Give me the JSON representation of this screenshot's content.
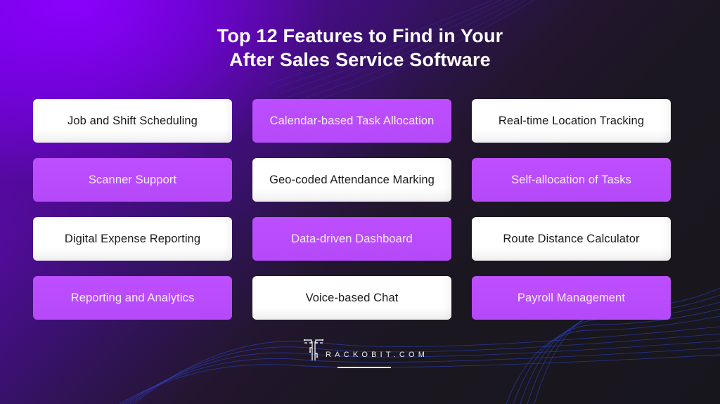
{
  "title": {
    "line1": "Top 12 Features to Find in Your",
    "line2": "After Sales Service Software"
  },
  "features": [
    {
      "label": "Job and Shift Scheduling",
      "style": "white"
    },
    {
      "label": "Calendar-based Task Allocation",
      "style": "purple"
    },
    {
      "label": "Real-time Location Tracking",
      "style": "white"
    },
    {
      "label": "Scanner Support",
      "style": "purple"
    },
    {
      "label": "Geo-coded Attendance Marking",
      "style": "white"
    },
    {
      "label": "Self-allocation of Tasks",
      "style": "purple"
    },
    {
      "label": "Digital Expense Reporting",
      "style": "white"
    },
    {
      "label": "Data-driven Dashboard",
      "style": "purple"
    },
    {
      "label": "Route Distance Calculator",
      "style": "white"
    },
    {
      "label": "Reporting and Analytics",
      "style": "purple"
    },
    {
      "label": "Voice-based Chat",
      "style": "white"
    },
    {
      "label": "Payroll Management",
      "style": "purple"
    }
  ],
  "branding": {
    "logo_icon": "trackobit-t-circuit-icon",
    "logo_text": "RACKOBIT.COM"
  },
  "colors": {
    "accent_purple": "#bd4eff",
    "card_white": "#ffffff",
    "background_dark": "#1a1620",
    "background_purple": "#8a00ff"
  }
}
